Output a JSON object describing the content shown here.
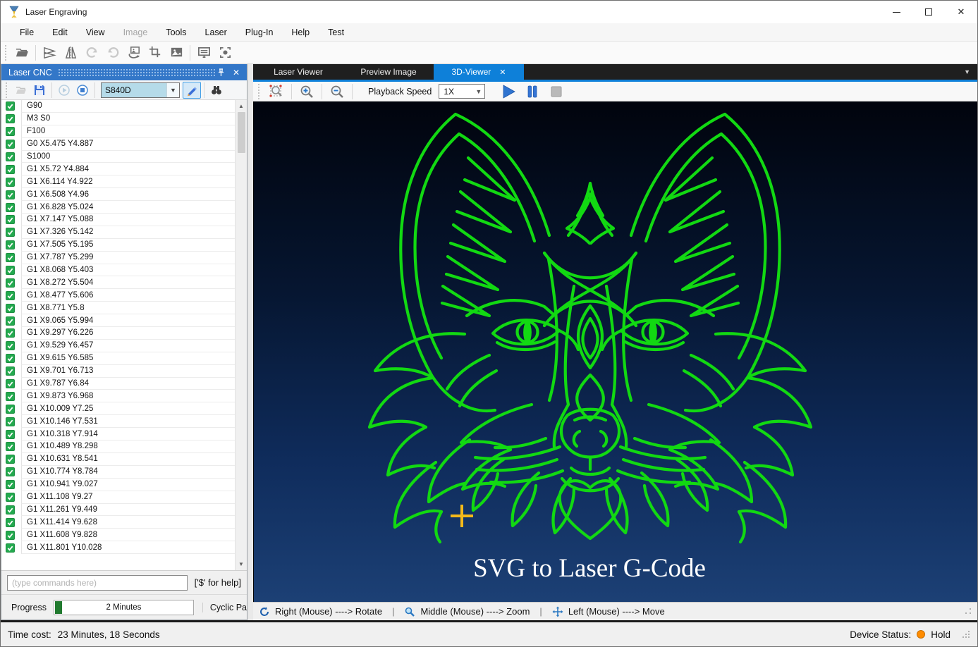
{
  "window": {
    "title": "Laser Engraving"
  },
  "menu": {
    "items": [
      {
        "label": "File",
        "enabled": true
      },
      {
        "label": "Edit",
        "enabled": true
      },
      {
        "label": "View",
        "enabled": true
      },
      {
        "label": "Image",
        "enabled": false
      },
      {
        "label": "Tools",
        "enabled": true
      },
      {
        "label": "Laser",
        "enabled": true
      },
      {
        "label": "Plug-In",
        "enabled": true
      },
      {
        "label": "Help",
        "enabled": true
      },
      {
        "label": "Test",
        "enabled": true
      }
    ]
  },
  "main_toolbar": {
    "icons": [
      "open-file-icon",
      "flip-vertical-icon",
      "flip-horizontal-icon",
      "rotate-cw-icon",
      "rotate-ccw-icon",
      "rotate-image-icon",
      "crop-icon",
      "image-icon",
      "display-icon",
      "focus-capture-icon"
    ]
  },
  "laser_cnc": {
    "title": "Laser CNC",
    "toolbar": {
      "icons": [
        "open-icon",
        "save-icon",
        "run-icon",
        "stop-icon",
        "edit-pencil-icon",
        "search-binoculars-icon"
      ],
      "device_selector_value": "S840D"
    },
    "gcode_lines": [
      "G90",
      "M3 S0",
      "F100",
      "G0 X5.475 Y4.887",
      "S1000",
      "G1 X5.72 Y4.884",
      "G1 X6.114 Y4.922",
      "G1 X6.508 Y4.96",
      "G1 X6.828 Y5.024",
      "G1 X7.147 Y5.088",
      "G1 X7.326 Y5.142",
      "G1 X7.505 Y5.195",
      "G1 X7.787 Y5.299",
      "G1 X8.068 Y5.403",
      "G1 X8.272 Y5.504",
      "G1 X8.477 Y5.606",
      "G1 X8.771 Y5.8",
      "G1 X9.065 Y5.994",
      "G1 X9.297 Y6.226",
      "G1 X9.529 Y6.457",
      "G1 X9.615 Y6.585",
      "G1 X9.701 Y6.713",
      "G1 X9.787 Y6.84",
      "G1 X9.873 Y6.968",
      "G1 X10.009 Y7.25",
      "G1 X10.146 Y7.531",
      "G1 X10.318 Y7.914",
      "G1 X10.489 Y8.298",
      "G1 X10.631 Y8.541",
      "G1 X10.774 Y8.784",
      "G1 X10.941 Y9.027",
      "G1 X11.108 Y9.27",
      "G1 X11.261 Y9.449",
      "G1 X11.414 Y9.628",
      "G1 X11.608 Y9.828",
      "G1 X11.801 Y10.028"
    ],
    "command_input": {
      "placeholder": "(type commands here)",
      "help_label": "['$' for help]"
    },
    "progress": {
      "label": "Progress",
      "bar_text": "2 Minutes",
      "percent": 5,
      "right_label": "Cyclic Pa"
    }
  },
  "viewer": {
    "tabs": [
      {
        "label": "Laser Viewer",
        "active": false
      },
      {
        "label": "Preview Image",
        "active": false
      },
      {
        "label": "3D-Viewer",
        "active": true,
        "close_glyph": "✕"
      }
    ],
    "toolbar": {
      "playback_speed_label": "Playback Speed",
      "speed_value": "1X"
    },
    "canvas": {
      "caption": "SVG to Laser G-Code",
      "line_color": "#12d912",
      "crosshair_color": "#f5b91a",
      "background_top": "#01040d",
      "background_bottom": "#1c4075"
    },
    "statusbar_hints": [
      {
        "icon": "rotate-icon",
        "text": "Right (Mouse) ----> Rotate"
      },
      {
        "icon": "zoom-icon",
        "text": "Middle  (Mouse) ----> Zoom"
      },
      {
        "icon": "move-icon",
        "text": "Left (Mouse) ----> Move"
      }
    ]
  },
  "statusbar": {
    "time_cost_label": "Time cost:",
    "time_cost_value": "23 Minutes, 18 Seconds",
    "device_status_label": "Device Status:",
    "device_status_value": "Hold",
    "device_status_color": "#ff8c00"
  }
}
